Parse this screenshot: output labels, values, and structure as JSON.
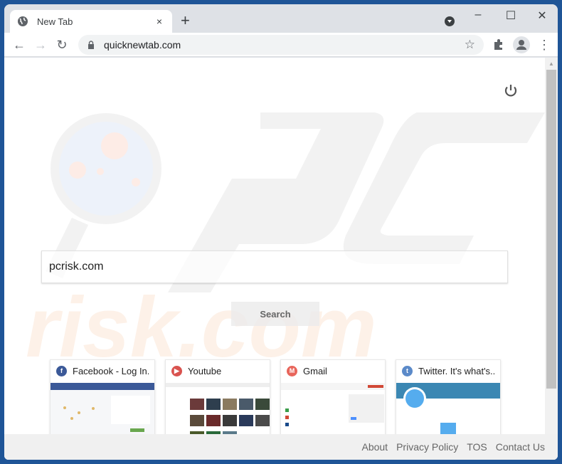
{
  "browser": {
    "tab": {
      "title": "New Tab",
      "close": "×"
    },
    "new_tab": "+",
    "window_controls": {
      "minimize": "–",
      "maximize": "☐",
      "close": "✕"
    },
    "nav": {
      "back": "←",
      "forward": "→",
      "reload": "↻"
    },
    "address": {
      "url": "quicknewtab.com"
    },
    "star": "☆",
    "menu": "⋮"
  },
  "page": {
    "search": {
      "value": "pcrisk.com",
      "button": "Search"
    },
    "watermark": {
      "top": "PC",
      "bottom": "risk.com"
    },
    "tiles": [
      {
        "title": "Facebook - Log In...",
        "icon_glyph": "f",
        "icon_color": "#3b5998"
      },
      {
        "title": "Youtube",
        "icon_glyph": "▶",
        "icon_color": "#d9534f"
      },
      {
        "title": "Gmail",
        "icon_glyph": "M",
        "icon_color": "#e8655b"
      },
      {
        "title": "Twitter. It's what's...",
        "icon_glyph": "t",
        "icon_color": "#5b8ac9"
      }
    ],
    "footer": {
      "links": [
        "About",
        "Privacy Policy",
        "TOS",
        "Contact Us"
      ]
    }
  }
}
